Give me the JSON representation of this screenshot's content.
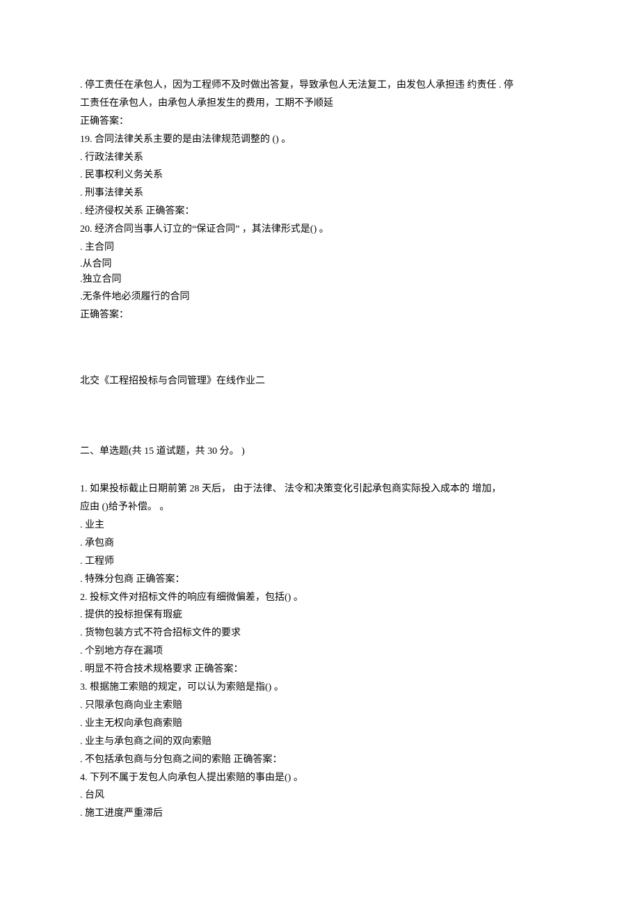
{
  "part1": {
    "q18_tail_line1": ". 停工责任在承包人，因为工程师不及时做出答复，导致承包人无法复工，由发包人承担违  约责任  . 停",
    "q18_tail_line2": "工责任在承包人，由承包人承担发生的费用，工期不予顺延",
    "q18_answer_label": "正确答案：",
    "q19_num": "19.",
    "q19_text": "     合同法律关系主要的是由法律规范调整的  () 。",
    "q19_opt1": ". 行政法律关系",
    "q19_opt2": ". 民事权利义务关系",
    "q19_opt3": ". 刑事法律关系",
    "q19_opt4": ". 经济侵权关系  正确答案：",
    "q20_num": "20.",
    "q20_text": "     经济合同当事人订立的“保证合同”  ，其法律形式是() 。",
    "q20_opt1": ". 主合同",
    "q20_opt2": ".从合同",
    "q20_opt3": ".独立合同",
    "q20_opt4": ".无条件地必须履行的合同",
    "q20_answer_label": "正确答案："
  },
  "title": "北交《工程招投标与合同管理》在线作业二",
  "section_header": "二、单选题(共 15 道试题，共  30 分。  )",
  "part2": {
    "q1_num": "1.",
    "q1_line1": "     如果投标截止日期前第  28 天后，  由于法律、  法令和决策变化引起承包商实际投入成本的  增加，",
    "q1_line2": "应由 ()给予补偿。  。",
    "q1_opt1": ". 业主",
    "q1_opt2": ". 承包商",
    "q1_opt3": ". 工程师",
    "q1_opt4": ". 特殊分包商  正确答案：",
    "q2_num": "2.",
    "q2_text": "     投标文件对招标文件的响应有细微偏差，包括() 。",
    "q2_opt1": ". 提供的投标担保有瑕疵",
    "q2_opt2": ". 货物包装方式不符合招标文件的要求",
    "q2_opt3": ". 个别地方存在漏项",
    "q2_opt4": ". 明显不符合技术规格要求  正确答案：",
    "q3_num": "3.",
    "q3_text": "     根据施工索赔的规定，可以认为索赔是指() 。",
    "q3_opt1": ". 只限承包商向业主索赔",
    "q3_opt2": ". 业主无权向承包商索赔",
    "q3_opt3": ". 业主与承包商之间的双向索赔",
    "q3_opt4": ". 不包括承包商与分包商之间的索赔  正确答案：",
    "q4_num": "4.",
    "q4_text": "     下列不属于发包人向承包人提出索赔的事由是() 。",
    "q4_opt1": ". 台风",
    "q4_opt2": ". 施工进度严重滞后"
  }
}
